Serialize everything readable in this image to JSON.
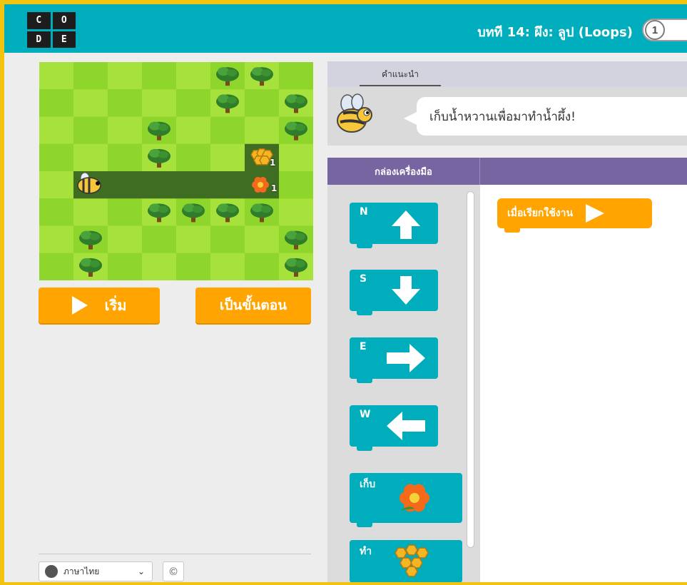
{
  "header": {
    "logo_letters": [
      "C",
      "O",
      "D",
      "E"
    ],
    "lesson_title": "บทที 14: ผึง: ลูป (Loops)",
    "level_number": "1"
  },
  "maze": {
    "flower_count": "1",
    "honeycomb_count": "1"
  },
  "controls": {
    "run_label": "เริ่ม",
    "step_label": "เป็นขั้นตอน"
  },
  "footer": {
    "language": "ภาษาไทย",
    "copyright": "©"
  },
  "instructions": {
    "tab_label": "คำแนะนำ",
    "message": "เก็บน้ำหวานเพื่อมาทำน้ำผึ้ง!"
  },
  "toolbox": {
    "header_label": "กล่องเครื่องมือ",
    "blocks": [
      {
        "label": "N",
        "icon": "arrow-up-icon"
      },
      {
        "label": "S",
        "icon": "arrow-down-icon"
      },
      {
        "label": "E",
        "icon": "arrow-right-icon"
      },
      {
        "label": "W",
        "icon": "arrow-left-icon"
      },
      {
        "label": "เก็บ",
        "icon": "flower-icon"
      },
      {
        "label": "ทำ",
        "icon": "honeycomb-icon"
      }
    ]
  },
  "workspace": {
    "when_run_label": "เมื่อเรียกใช้งาน"
  },
  "colors": {
    "header": "#00adbc",
    "toolbox_header": "#7665a0",
    "orange": "#ffa400",
    "block": "#00adbc",
    "border": "#f2c30f"
  }
}
